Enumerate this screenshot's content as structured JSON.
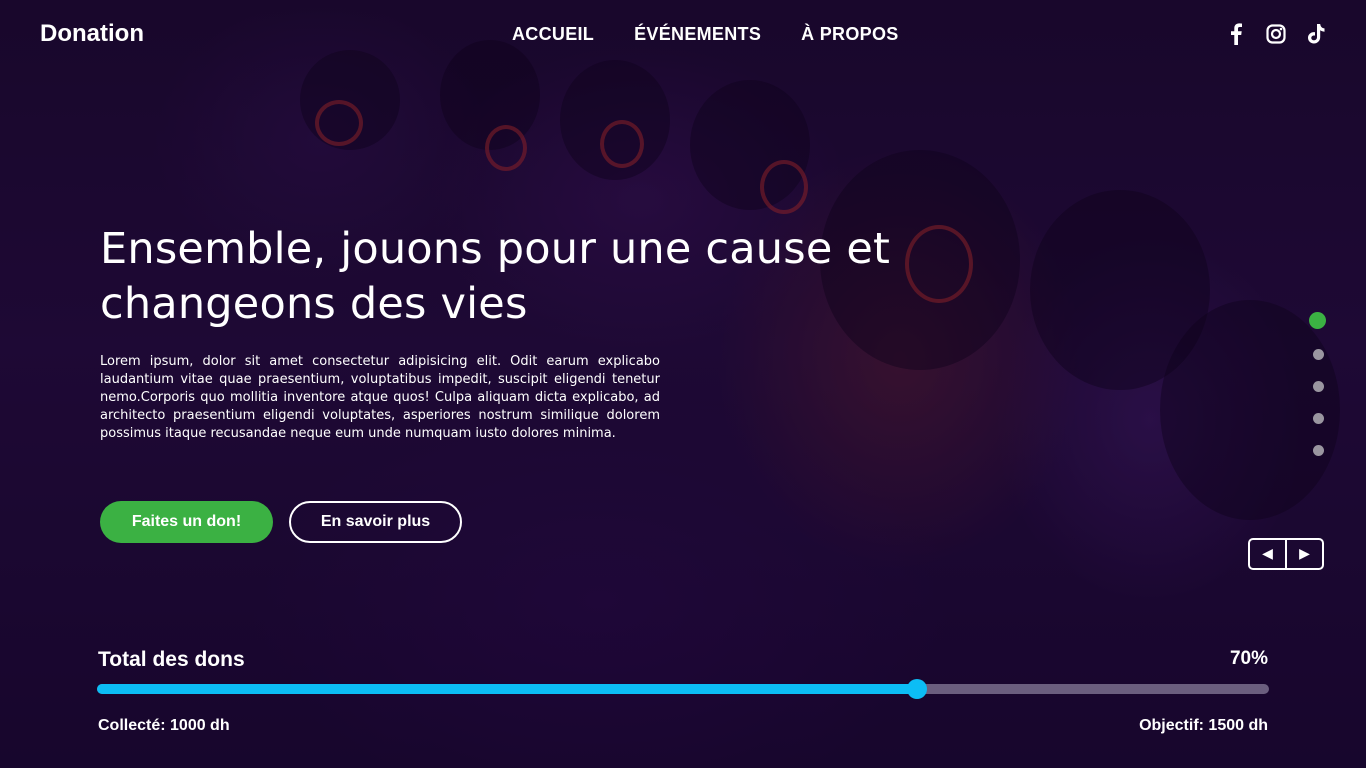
{
  "header": {
    "logo": "Donation",
    "nav": [
      "ACCUEIL",
      "ÉVÉNEMENTS",
      "À PROPOS"
    ],
    "socials": [
      "facebook-icon",
      "instagram-icon",
      "tiktok-icon"
    ]
  },
  "hero": {
    "title_line1": "Ensemble, jouons pour une cause et",
    "title_line2": "changeons des vies",
    "description": "Lorem ipsum, dolor sit amet consectetur adipisicing elit. Odit earum explicabo laudantium vitae quae praesentium, voluptatibus impedit, suscipit eligendi tenetur nemo.Corporis quo mollitia inventore atque quos! Culpa aliquam dicta explicabo, ad architecto praesentium eligendi voluptates, asperiores nostrum similique dolorem possimus itaque recusandae neque eum unde numquam iusto dolores minima.",
    "primary_button": "Faites un don!",
    "secondary_button": "En savoir plus"
  },
  "slider": {
    "slide_count": 5,
    "active_slide": 1,
    "prev_symbol": "◀",
    "next_symbol": "▶"
  },
  "progress": {
    "title": "Total des dons",
    "percent_label": "70%",
    "percent": 0.7,
    "collected": "Collecté: 1000 dh",
    "goal": "Objectif: 1500 dh"
  },
  "colors": {
    "accent_green": "#3bb143",
    "progress_blue": "#0cbdf5",
    "track": "#6b5e7e",
    "overlay": "#1c0a2e"
  }
}
